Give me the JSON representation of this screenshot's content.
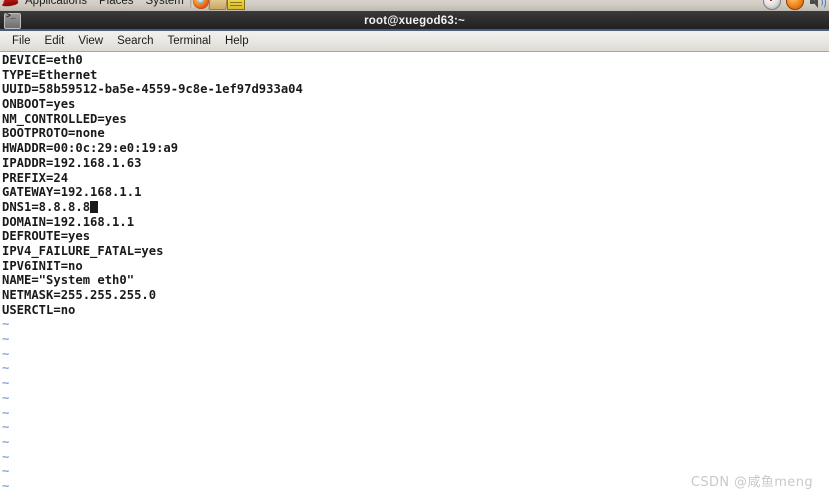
{
  "desktop_panel": {
    "logo_icon": "redhat-logo-icon",
    "menus": [
      "Applications",
      "Places",
      "System"
    ],
    "launchers": [
      {
        "name": "firefox-icon",
        "label": "Firefox"
      },
      {
        "name": "file-manager-icon",
        "label": "File Manager"
      },
      {
        "name": "writer-icon",
        "label": "Writer"
      }
    ],
    "tray": [
      {
        "name": "updates-icon",
        "label": "Updates"
      },
      {
        "name": "alert-icon",
        "label": "Alert"
      },
      {
        "name": "volume-icon",
        "label": "Volume"
      }
    ]
  },
  "window": {
    "icon": "terminal-icon",
    "title": "root@xuegod63:~"
  },
  "menubar": {
    "items": [
      {
        "label": "File",
        "name": "menu-file"
      },
      {
        "label": "Edit",
        "name": "menu-edit"
      },
      {
        "label": "View",
        "name": "menu-view"
      },
      {
        "label": "Search",
        "name": "menu-search"
      },
      {
        "label": "Terminal",
        "name": "menu-terminal"
      },
      {
        "label": "Help",
        "name": "menu-help"
      }
    ]
  },
  "terminal": {
    "lines": [
      "DEVICE=eth0",
      "TYPE=Ethernet",
      "UUID=58b59512-ba5e-4559-9c8e-1ef97d933a04",
      "ONBOOT=yes",
      "NM_CONTROLLED=yes",
      "BOOTPROTO=none",
      "HWADDR=00:0c:29:e0:19:a9",
      "IPADDR=192.168.1.63",
      "PREFIX=24",
      "GATEWAY=192.168.1.1",
      "DNS1=8.8.8.8",
      "DOMAIN=192.168.1.1",
      "DEFROUTE=yes",
      "IPV4_FAILURE_FATAL=yes",
      "IPV6INIT=no",
      "NAME=\"System eth0\"",
      "NETMASK=255.255.255.0",
      "USERCTL=no"
    ],
    "cursor_line_index": 10,
    "cursor_text": "DNS1=8.8.8.8",
    "tilde_count": 12,
    "tilde_char": "~",
    "text_color": "#1a1a1a",
    "tilde_color": "#8ba7d8",
    "background_color": "#ffffff"
  },
  "watermark": {
    "text": "CSDN @咸鱼meng"
  }
}
